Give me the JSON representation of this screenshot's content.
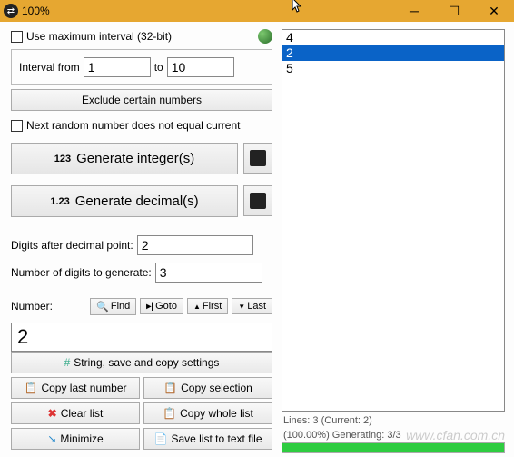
{
  "title": "100%",
  "use_max_interval_label": "Use maximum interval (32-bit)",
  "interval_from_label": "Interval from",
  "interval_from_value": "1",
  "interval_to_label": "to",
  "interval_to_value": "10",
  "exclude_label": "Exclude certain numbers",
  "no_repeat_label": "Next random number does not equal current",
  "gen_int_prefix": "123",
  "gen_int_label": "Generate integer(s)",
  "gen_dec_prefix": "1.23",
  "gen_dec_label": "Generate decimal(s)",
  "digits_decimal_label": "Digits after decimal point:",
  "digits_decimal_value": "2",
  "num_digits_label": "Number of digits to generate:",
  "num_digits_value": "3",
  "number_label": "Number:",
  "find_label": "Find",
  "goto_label": "Goto",
  "first_label": "First",
  "last_label": "Last",
  "number_value": "2",
  "string_settings_label": "String, save and copy settings",
  "copy_last_label": "Copy last number",
  "copy_sel_label": "Copy selection",
  "clear_list_label": "Clear list",
  "copy_whole_label": "Copy whole list",
  "minimize_label": "Minimize",
  "save_file_label": "Save list to text file",
  "list": [
    "4",
    "2",
    "5"
  ],
  "selected_index": 1,
  "status_lines": "Lines: 3 (Current: 2)",
  "status_progress": "(100.00%) Generating: 3/3",
  "watermark": "www.cfan.com.cn"
}
